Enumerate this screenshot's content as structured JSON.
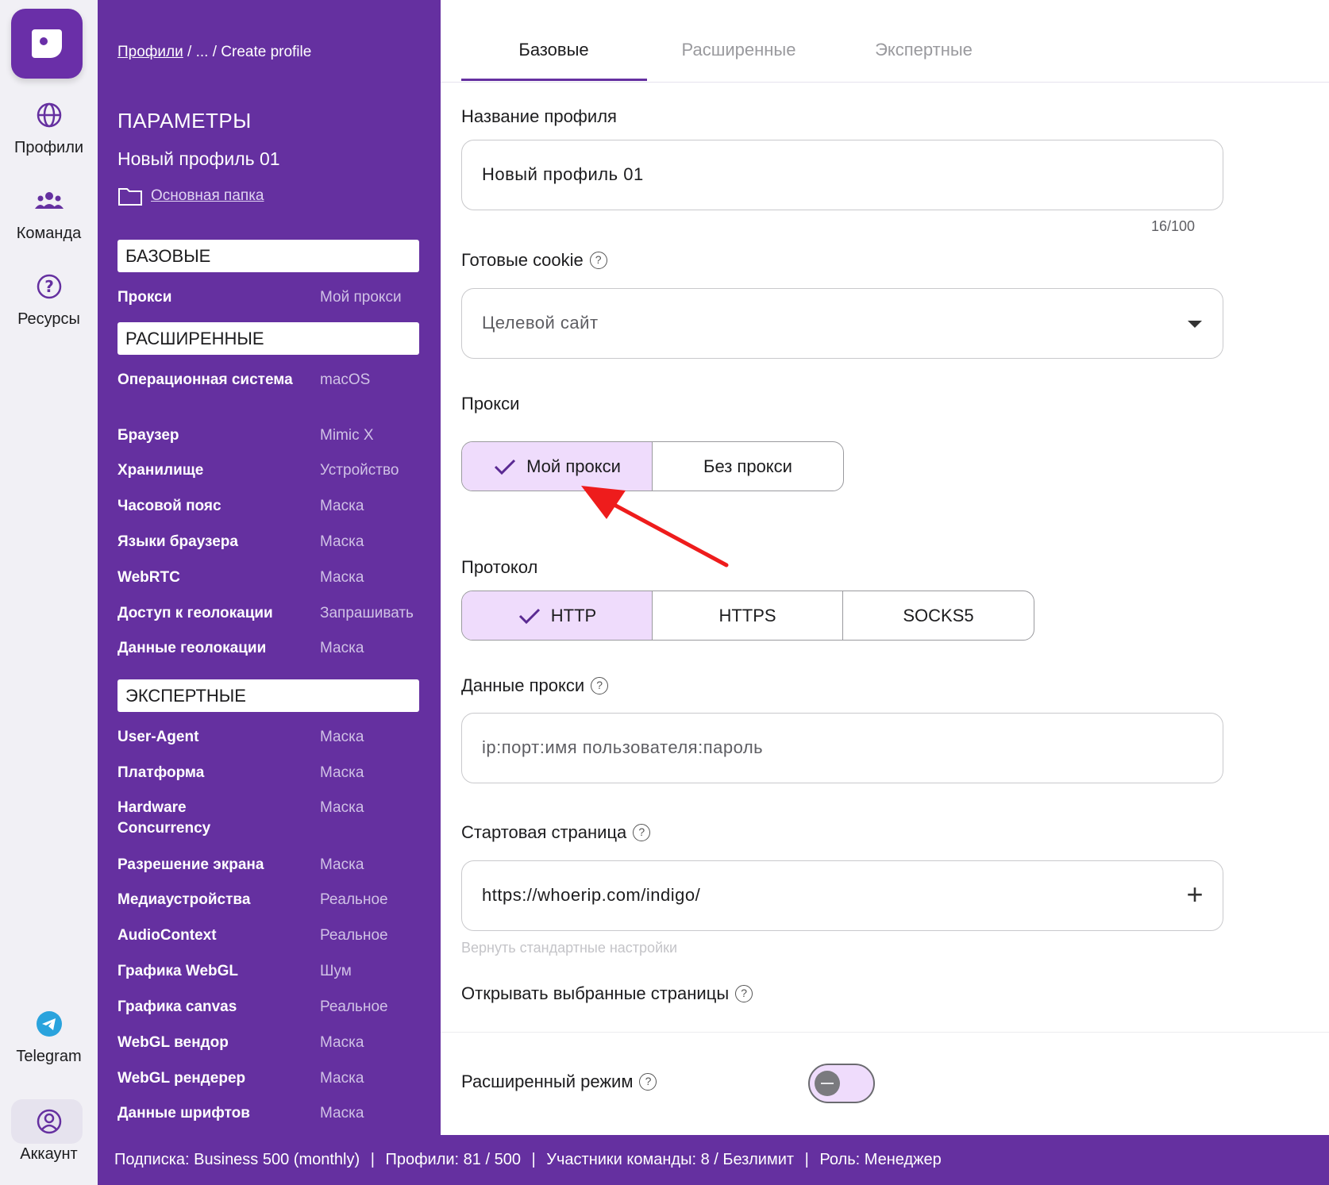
{
  "rail": {
    "items": [
      {
        "label": "Профили",
        "icon": "globe-icon"
      },
      {
        "label": "Команда",
        "icon": "team-icon"
      },
      {
        "label": "Ресурсы",
        "icon": "question-icon"
      }
    ],
    "telegram": "Telegram",
    "account": "Аккаунт"
  },
  "sidebar": {
    "breadcrumb": {
      "root": "Профили",
      "sep": " / ... / ",
      "current": "Create profile"
    },
    "heading": "ПАРАМЕТРЫ",
    "profile_name": "Новый профиль 01",
    "folder": "Основная папка",
    "sections": [
      {
        "title": "БАЗОВЫЕ",
        "rows": [
          {
            "key": "Прокси",
            "value": "Мой прокси"
          }
        ]
      },
      {
        "title": "РАСШИРЕННЫЕ",
        "rows": [
          {
            "key": "Операционная система",
            "value": "macOS"
          },
          {
            "key": "Браузер",
            "value": "Mimic X"
          },
          {
            "key": "Хранилище",
            "value": "Устройство"
          },
          {
            "key": "Часовой пояс",
            "value": "Маска"
          },
          {
            "key": "Языки браузера",
            "value": "Маска"
          },
          {
            "key": "WebRTC",
            "value": "Маска"
          },
          {
            "key": "Доступ к геолокации",
            "value": "Запрашивать"
          },
          {
            "key": "Данные геолокации",
            "value": "Маска"
          }
        ]
      },
      {
        "title": "ЭКСПЕРТНЫЕ",
        "rows": [
          {
            "key": "User-Agent",
            "value": "Маска"
          },
          {
            "key": "Платформа",
            "value": "Маска"
          },
          {
            "key": "Hardware Concurrency",
            "value": "Маска"
          },
          {
            "key": "Разрешение экрана",
            "value": "Маска"
          },
          {
            "key": "Медиаустройства",
            "value": "Реальное"
          },
          {
            "key": "AudioContext",
            "value": "Реальное"
          },
          {
            "key": "Графика WebGL",
            "value": "Шум"
          },
          {
            "key": "Графика canvas",
            "value": "Реальное"
          },
          {
            "key": "WebGL вендор",
            "value": "Маска"
          },
          {
            "key": "WebGL рендерер",
            "value": "Маска"
          },
          {
            "key": "Данные шрифтов",
            "value": "Маска"
          }
        ]
      }
    ]
  },
  "tabs": [
    "Базовые",
    "Расширенные",
    "Экспертные"
  ],
  "form": {
    "name_label": "Название профиля",
    "name_value": "Новый профиль 01",
    "name_counter": "16/100",
    "cookie_label": "Готовые cookie",
    "cookie_placeholder": "Целевой сайт",
    "proxy_label": "Прокси",
    "proxy_options": [
      "Мой прокси",
      "Без прокси"
    ],
    "protocol_label": "Протокол",
    "protocol_options": [
      "HTTP",
      "HTTPS",
      "SOCKS5"
    ],
    "proxy_data_label": "Данные прокси",
    "proxy_data_placeholder": "ip:порт:имя пользователя:пароль",
    "start_page_label": "Стартовая страница",
    "start_page_value": "https://whoerip.com/indigo/",
    "reset_link": "Вернуть стандартные настройки",
    "open_pages_label": "Открывать выбранные страницы",
    "advanced_mode_label": "Расширенный режим"
  },
  "footer": {
    "subscription": "Подписка: Business 500 (monthly)",
    "profiles": "Профили: 81 / 500",
    "members": "Участники команды: 8 / Безлимит",
    "role": "Роль: Менеджер"
  },
  "colors": {
    "brand": "#6530a0",
    "selected": "#efdcfc",
    "annotation": "#ee1c1c"
  }
}
